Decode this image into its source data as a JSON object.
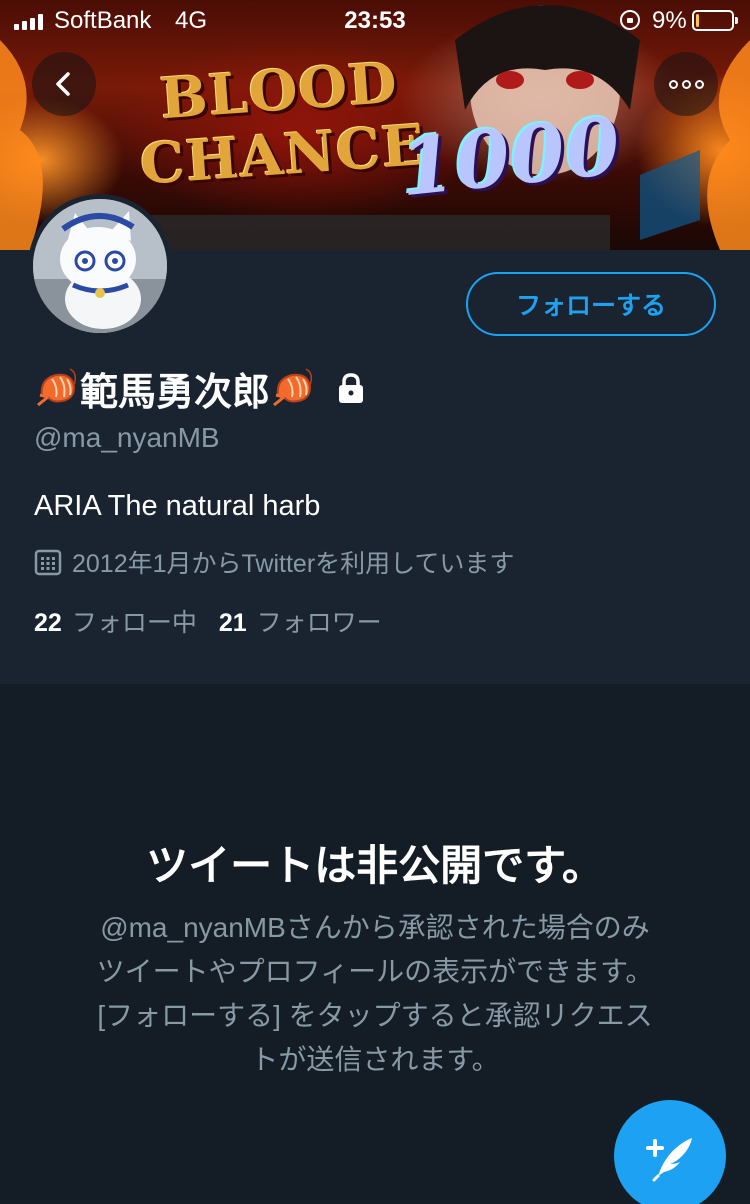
{
  "status_bar": {
    "carrier": "SoftBank",
    "network": "4G",
    "time": "23:53",
    "battery_percent": "9%",
    "battery_level": 0.09
  },
  "banner": {
    "text_line1": "BLOOD",
    "text_line2": "CHANCE",
    "text_number": "1000"
  },
  "profile": {
    "display_name": "範馬勇次郎",
    "handle": "@ma_nyanMB",
    "bio": "ARIA The natural harb",
    "joined": "2012年1月からTwitterを利用しています",
    "following_count": "22",
    "following_label": "フォロー中",
    "followers_count": "21",
    "followers_label": "フォロワー",
    "follow_button_label": "フォローする"
  },
  "private_notice": {
    "title": "ツイートは非公開です。",
    "line1": "@ma_nyanMBさんから承認された場合のみ",
    "line2": "ツイートやプロフィールの表示ができます。",
    "line3": "[フォローする] をタップすると承認リクエス",
    "line4": "トが送信されます。"
  },
  "icons": {
    "back": "chevron-left-icon",
    "more": "more-dots-icon",
    "lock": "lock-icon",
    "calendar": "calendar-icon",
    "compose": "compose-tweet-icon",
    "name_emoji": "shrimp-icon"
  },
  "colors": {
    "accent": "#1da1f2",
    "background": "#141d26",
    "profile_background": "#1a2430",
    "secondary_text": "#8899a6"
  }
}
